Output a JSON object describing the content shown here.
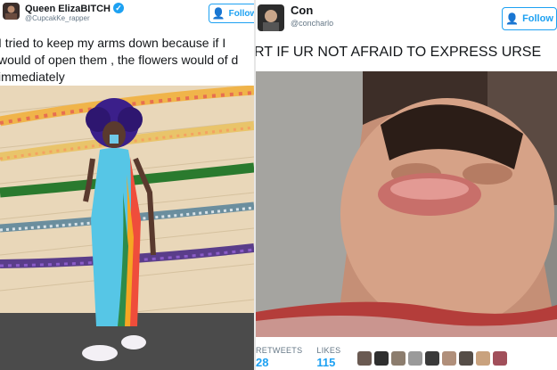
{
  "left_tweet": {
    "user_name": "Queen ElizaBITCH",
    "user_handle": "@CupcakKe_rapper",
    "verified": true,
    "follow_label": "Follow",
    "text_lines": [
      "I tried to keep my arms down because if I",
      "would of open them , the flowers would of d",
      "immediately"
    ]
  },
  "right_tweet": {
    "user_name": "Con",
    "user_handle": "@concharlo",
    "follow_label": "Follow",
    "text": "RT IF UR NOT AFRAID TO EXPRESS URSE",
    "retweets_label": "RETWEETS",
    "retweets_count": "28",
    "likes_label": "LIKES",
    "likes_count": "115"
  },
  "colors": {
    "accent": "#1da1f2",
    "name_text": "#14171a",
    "secondary_text": "#657786"
  },
  "icons": {
    "verified": "verified-badge-icon",
    "follow": "follow-person-plus-icon"
  }
}
